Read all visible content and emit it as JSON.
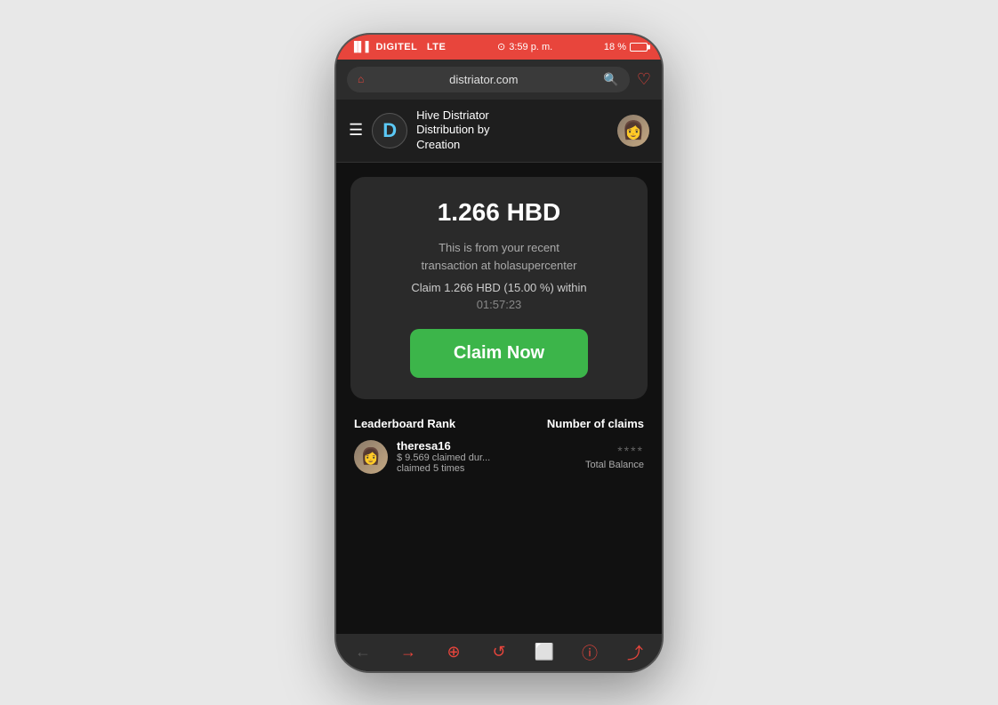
{
  "statusBar": {
    "carrier": "DIGITEL",
    "network": "LTE",
    "time": "3:59 p. m.",
    "battery": "18 %"
  },
  "urlBar": {
    "url": "distriator.com",
    "homeIcon": "🏠",
    "searchIcon": "🔍",
    "heartIcon": "♡"
  },
  "header": {
    "logoLetter": "D",
    "appTitle": "Hive Distriator\nDistribution by\nCreation",
    "menuIcon": "☰"
  },
  "claimCard": {
    "amount": "1.266 HBD",
    "descLine1": "This is from your recent",
    "descLine2": "transaction at holasupercenter",
    "claimDetail": "Claim 1.266 HBD (15.00 %) within",
    "timer": "01:57:23",
    "claimButtonLabel": "Claim Now"
  },
  "leaderboard": {
    "col1Title": "Leaderboard Rank",
    "col2Title": "Number of claims",
    "user": {
      "username": "theresa16",
      "amount": "$ 9.569 claimed dur...",
      "claimedTimes": "claimed 5 times",
      "stars": "****",
      "balanceLabel": "Total Balance"
    }
  },
  "browserNav": {
    "back": "←",
    "forward": "→",
    "add": "⊕",
    "refresh": "↺",
    "tablet": "⬜",
    "info": "ⓘ",
    "share": "⤴"
  }
}
